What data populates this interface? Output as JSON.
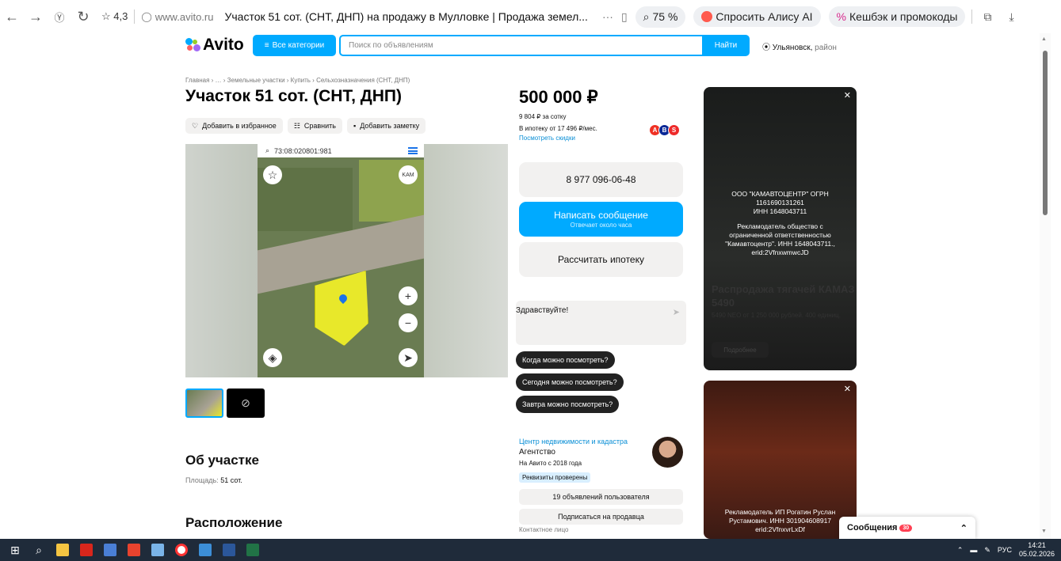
{
  "browser": {
    "rating": "☆ 4,3",
    "url": "www.avito.ru",
    "tab_title": "Участок 51 сот. (СНТ, ДНП) на продажу в Мулловке | Продажа земел...",
    "zoom": "75 %",
    "alice_label": "Спросить Алису AI",
    "cashback_label": "Кешбэк и промокоды"
  },
  "header": {
    "logo": "Avito",
    "categories_label": "Все категории",
    "search_placeholder": "Поиск по объявлениям",
    "search_button": "Найти",
    "location_city": "Ульяновск,",
    "location_area": "район"
  },
  "listing": {
    "breadcrumb": "Главная › … › Земельные участки › Купить › Сельхозназначения (СНТ, ДНП)",
    "title": "Участок 51 сот. (СНТ, ДНП)",
    "actions": {
      "favorite": "Добавить в избранное",
      "compare": "Сравнить",
      "note": "Добавить заметку"
    },
    "map_search_text": "73:08:020801:981",
    "about_title": "Об участке",
    "area_label": "Площадь:",
    "area_value": "51 сот.",
    "location_title": "Расположение"
  },
  "pricing": {
    "price": "500 000 ₽",
    "per_unit": "9 804 ₽ за сотку",
    "mortgage": "В ипотеку от 17 496 ₽/мес.",
    "discount_link": "Посмотреть скидки",
    "phone": "8 977 096-06-48",
    "message_button": "Написать сообщение",
    "message_sub": "Отвечает около часа",
    "mortgage_button": "Рассчитать ипотеку"
  },
  "chat": {
    "greeting": "Здравствуйте!",
    "quick_replies": [
      "Когда можно посмотреть?",
      "Сегодня можно посмотреть?",
      "Завтра можно посмотреть?"
    ]
  },
  "seller": {
    "name": "Центр недвижимости и кадастра",
    "type": "Агентство",
    "since": "На Авито с 2018 года",
    "verified": "Реквизиты проверены",
    "listings_button": "19 объявлений пользователя",
    "subscribe_button": "Подписаться на продавца",
    "contact_label": "Контактное лицо"
  },
  "ads": {
    "ad1_lines": [
      "ООО \"КАМАВТОЦЕНТР\" ОГРН",
      "1161690131261",
      "ИНН 1648043711",
      "",
      "Рекламодатель общество с",
      "ограниченной ответственностью",
      "\"Камавтоцентр\". ИНН 1648043711.,",
      "erid:2VfnxwmwcJD"
    ],
    "ad1_title": "Распродажа тягачей КАМАЗ 5490",
    "ad1_sub": "5490 NEO от 1 250 000 рублей. 400 единиц.",
    "ad1_more": "Подробнее",
    "ad2_lines": [
      "Рекламодатель ИП Рогатин Руслан",
      "Рустамович. ИНН 301904608917",
      "erid:2VfnxvrLxDf"
    ]
  },
  "messages": {
    "label": "Сообщения",
    "badge": "30"
  },
  "taskbar": {
    "lang": "РУС",
    "time": "14:21",
    "date": "05.02.2026"
  },
  "colors": {
    "brand_blue": "#00aaff",
    "link_blue": "#0a8fd6",
    "taskbar": "#1f2b3a"
  }
}
